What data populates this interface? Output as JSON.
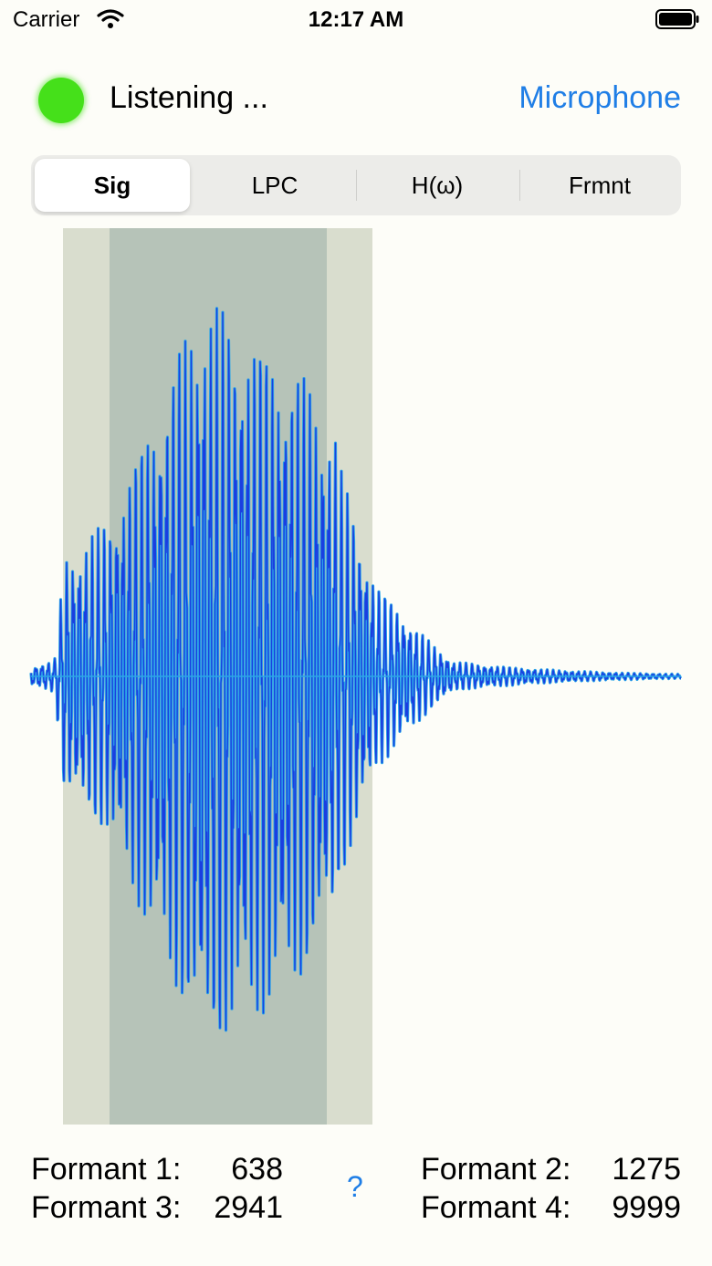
{
  "status_bar": {
    "carrier": "Carrier",
    "time": "12:17 AM",
    "icons": [
      "wifi-icon",
      "battery-icon"
    ]
  },
  "header": {
    "indicator_color": "#45e01a",
    "status_text": "Listening ...",
    "source_button": "Microphone"
  },
  "tabs": [
    {
      "label": "Sig",
      "selected": true
    },
    {
      "label": "LPC",
      "selected": false
    },
    {
      "label": "H(ω)",
      "selected": false
    },
    {
      "label": "Frmnt",
      "selected": false
    }
  ],
  "colors": {
    "waveform": "#1a3fe0",
    "waveform_edge": "#2aa6e8",
    "window_outer": "#d9ddce",
    "window_inner": "#b6c3b8",
    "accent": "#1f7ee6"
  },
  "formants": {
    "f1_label": "Formant 1:",
    "f1_value": "638",
    "f2_label": "Formant 2:",
    "f2_value": "1275",
    "f3_label": "Formant 3:",
    "f3_value": "2941",
    "f4_label": "Formant 4:",
    "f4_value": "9999",
    "help": "?"
  }
}
